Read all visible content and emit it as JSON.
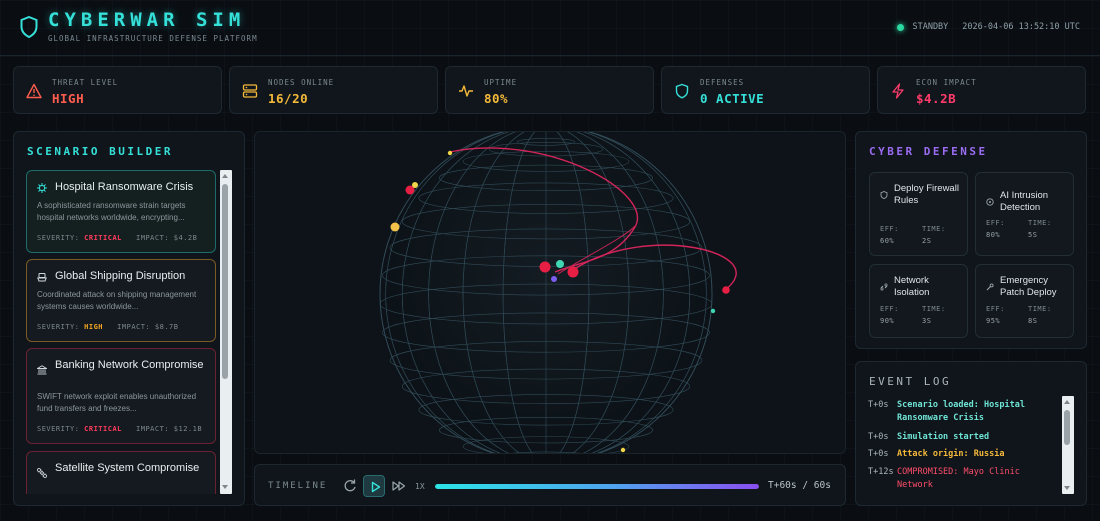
{
  "header": {
    "title": "CYBERWAR SIM",
    "subtitle": "GLOBAL INFRASTRUCTURE DEFENSE PLATFORM",
    "status": "STANDBY",
    "timestamp": "2026-04-06 13:52:10 UTC"
  },
  "stats": [
    {
      "label": "THREAT LEVEL",
      "value": "HIGH",
      "color": "#ff5c4d",
      "icon": "warning-triangle-icon"
    },
    {
      "label": "NODES ONLINE",
      "value": "16/20",
      "color": "#f5b93a",
      "icon": "server-icon"
    },
    {
      "label": "UPTIME",
      "value": "80%",
      "color": "#f5b93a",
      "icon": "pulse-icon"
    },
    {
      "label": "DEFENSES",
      "value": "0 ACTIVE",
      "color": "#35e0d8",
      "icon": "shield-icon"
    },
    {
      "label": "ECON IMPACT",
      "value": "$4.2B",
      "color": "#ff3b6b",
      "icon": "lightning-icon"
    }
  ],
  "scenario_builder": {
    "title": "SCENARIO BUILDER",
    "scenarios": [
      {
        "name": "Hospital Ransomware Crisis",
        "description": "A sophisticated ransomware strain targets hospital networks worldwide, encrypting...",
        "severity_label": "SEVERITY:",
        "severity": "CRITICAL",
        "impact_label": "IMPACT:",
        "impact": "$4.2B",
        "icon": "virus-icon",
        "border": "#1d6b6a"
      },
      {
        "name": "Global Shipping Disruption",
        "description": "Coordinated attack on shipping management systems causes worldwide...",
        "severity_label": "SEVERITY:",
        "severity": "HIGH",
        "impact_label": "IMPACT:",
        "impact": "$8.7B",
        "icon": "ship-icon",
        "border": "#7a5a23"
      },
      {
        "name": "Banking Network Compromise",
        "description": "SWIFT network exploit enables unauthorized fund transfers and freezes...",
        "severity_label": "SEVERITY:",
        "severity": "CRITICAL",
        "impact_label": "IMPACT:",
        "impact": "$12.1B",
        "icon": "bank-icon",
        "border": "#6b2230"
      },
      {
        "name": "Satellite System Compromise",
        "description": "",
        "severity_label": "",
        "severity": "",
        "impact_label": "",
        "impact": "",
        "icon": "satellite-icon",
        "border": "#6b2230"
      }
    ]
  },
  "timeline": {
    "label": "TIMELINE",
    "speed": "1X",
    "time": "T+60s / 60s",
    "progress": 1.0
  },
  "cyber_defense": {
    "title": "CYBER DEFENSE",
    "eff_label": "EFF:",
    "time_label": "TIME:",
    "defenses": [
      {
        "name": "Deploy Firewall Rules",
        "eff": "60%",
        "time": "2S",
        "icon": "firewall-icon"
      },
      {
        "name": "AI Intrusion Detection",
        "eff": "80%",
        "time": "5S",
        "icon": "ai-chip-icon"
      },
      {
        "name": "Network Isolation",
        "eff": "90%",
        "time": "3S",
        "icon": "unlink-icon"
      },
      {
        "name": "Emergency Patch Deploy",
        "eff": "95%",
        "time": "8S",
        "icon": "wrench-icon"
      }
    ]
  },
  "event_log": {
    "title": "EVENT LOG",
    "entries": [
      {
        "t": "T+0s",
        "msg": "Scenario loaded: Hospital Ransomware Crisis",
        "color": "#6fe3d4"
      },
      {
        "t": "T+0s",
        "msg": "Simulation started",
        "color": "#6fe3d4"
      },
      {
        "t": "T+0s",
        "msg": "Attack origin: Russia",
        "color": "#f5b93a"
      },
      {
        "t": "T+12s",
        "msg": "COMPROMISED: Mayo Clinic Network",
        "color": "#ff4d6a"
      }
    ]
  },
  "colors": {
    "accent": "#35e0d8",
    "defense_title": "#9b6cf2",
    "critical": "#ff3b5c",
    "high": "#f5a623"
  }
}
